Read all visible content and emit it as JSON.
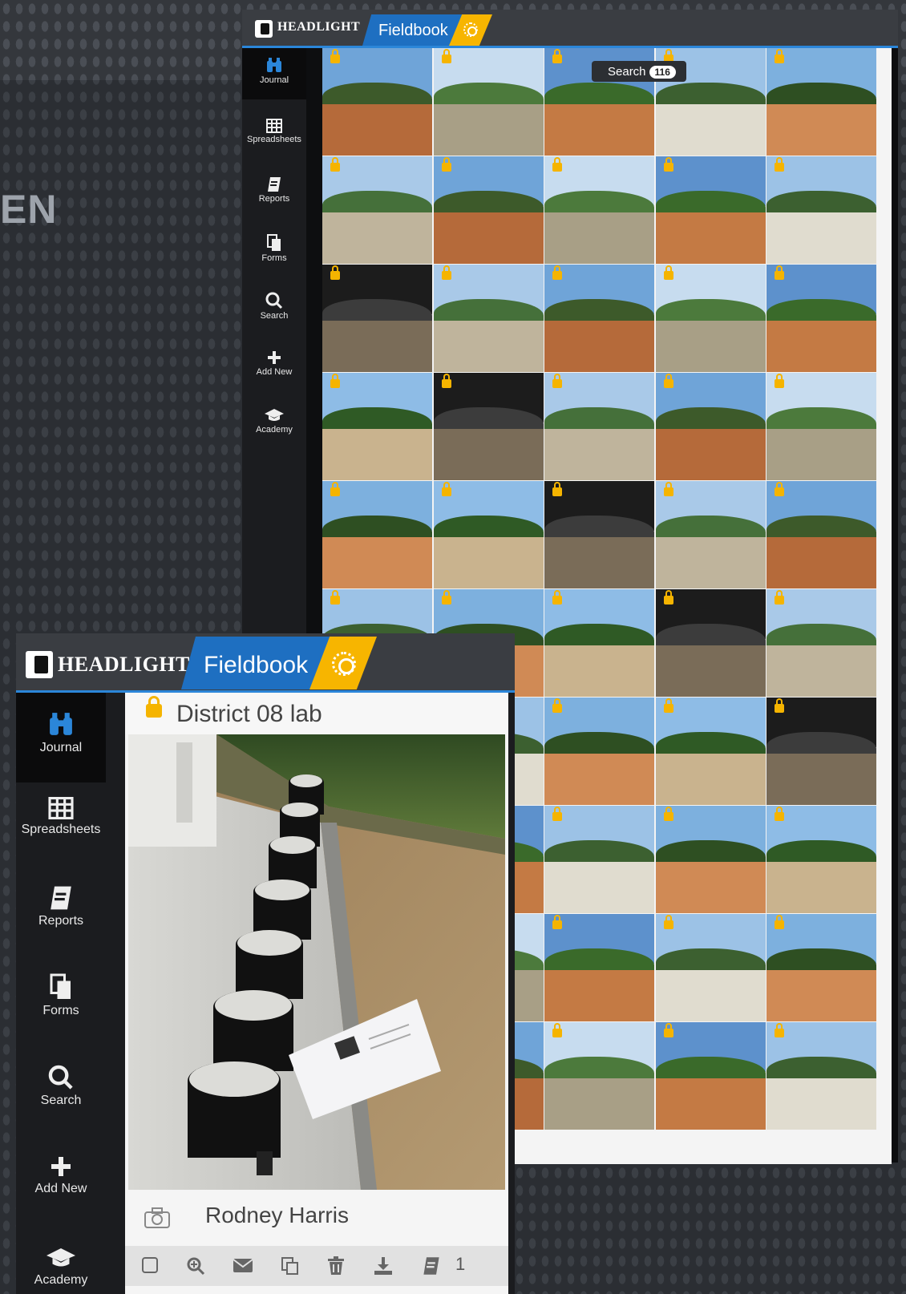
{
  "background": {
    "title": "EN"
  },
  "back_window": {
    "brand": "HEADLIGHT",
    "app_name": "Fieldbook",
    "nav": [
      {
        "label": "Journal",
        "icon": "binoculars-icon",
        "active": true
      },
      {
        "label": "Spreadsheets",
        "icon": "table-icon"
      },
      {
        "label": "Reports",
        "icon": "report-icon"
      },
      {
        "label": "Forms",
        "icon": "forms-icon"
      },
      {
        "label": "Search",
        "icon": "search-icon"
      },
      {
        "label": "Add New",
        "icon": "plus-icon"
      },
      {
        "label": "Academy",
        "icon": "graduation-cap-icon"
      }
    ],
    "search": {
      "label": "Search",
      "count": "116"
    },
    "photo_count_shown": 50
  },
  "front_window": {
    "brand": "HEADLIGHT",
    "app_name": "Fieldbook",
    "nav": [
      {
        "label": "Journal",
        "icon": "binoculars-icon",
        "active": true
      },
      {
        "label": "Spreadsheets",
        "icon": "table-icon"
      },
      {
        "label": "Reports",
        "icon": "report-icon"
      },
      {
        "label": "Forms",
        "icon": "forms-icon"
      },
      {
        "label": "Search",
        "icon": "search-icon"
      },
      {
        "label": "Add New",
        "icon": "plus-icon"
      },
      {
        "label": "Academy",
        "icon": "graduation-cap-icon"
      }
    ],
    "entry": {
      "title": "District 08 lab",
      "author": "Rodney Harris",
      "toolbar_icons": [
        "checkbox-icon",
        "zoom-in-icon",
        "envelope-icon",
        "copy-icon",
        "trash-icon",
        "download-icon",
        "report-icon"
      ],
      "report_count": "1"
    }
  },
  "colors": {
    "accent_blue": "#1e6fc1",
    "accent_yellow": "#f7b500",
    "sidebar": "#1b1c1f",
    "lock": "#f5b400"
  }
}
